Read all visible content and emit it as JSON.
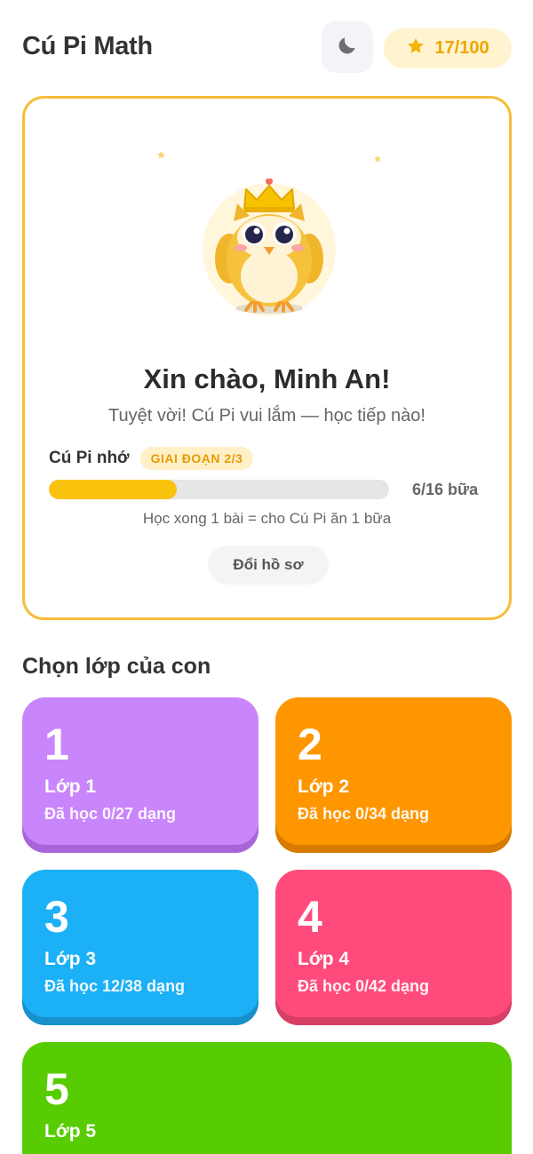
{
  "header": {
    "title": "Cú Pi Math",
    "theme_icon": "moon-icon",
    "stars": "17/100"
  },
  "hero": {
    "greeting": "Xin chào, Minh An!",
    "subtitle": "Tuyệt vời! Cú Pi vui lắm — học tiếp nào!",
    "pet_label": "Cú Pi nhớ",
    "stage": "GIAI ĐOẠN 2/3",
    "meal_progress": 0.375,
    "meal_count": "6/16 bữa",
    "hint": "Học xong 1 bài = cho Cú Pi ăn 1 bữa",
    "profile_button": "Đổi hồ sơ"
  },
  "grades_section": {
    "title": "Chọn lớp của con"
  },
  "grades": [
    {
      "number": "1",
      "name": "Lớp 1",
      "progress": "Đã học 0/27 dạng",
      "color": "#c985fb",
      "shade": "#a965d8"
    },
    {
      "number": "2",
      "name": "Lớp 2",
      "progress": "Đã học 0/34 dạng",
      "color": "#fe9600",
      "shade": "#d67b00"
    },
    {
      "number": "3",
      "name": "Lớp 3",
      "progress": "Đã học 12/38 dạng",
      "color": "#1cb0f6",
      "shade": "#1890cc"
    },
    {
      "number": "4",
      "name": "Lớp 4",
      "progress": "Đã học 0/42 dạng",
      "color": "#ff4b7c",
      "shade": "#d83f66"
    },
    {
      "number": "5",
      "name": "Lớp 5",
      "progress": "",
      "color": "#58cc02",
      "shade": "#46a302"
    }
  ]
}
